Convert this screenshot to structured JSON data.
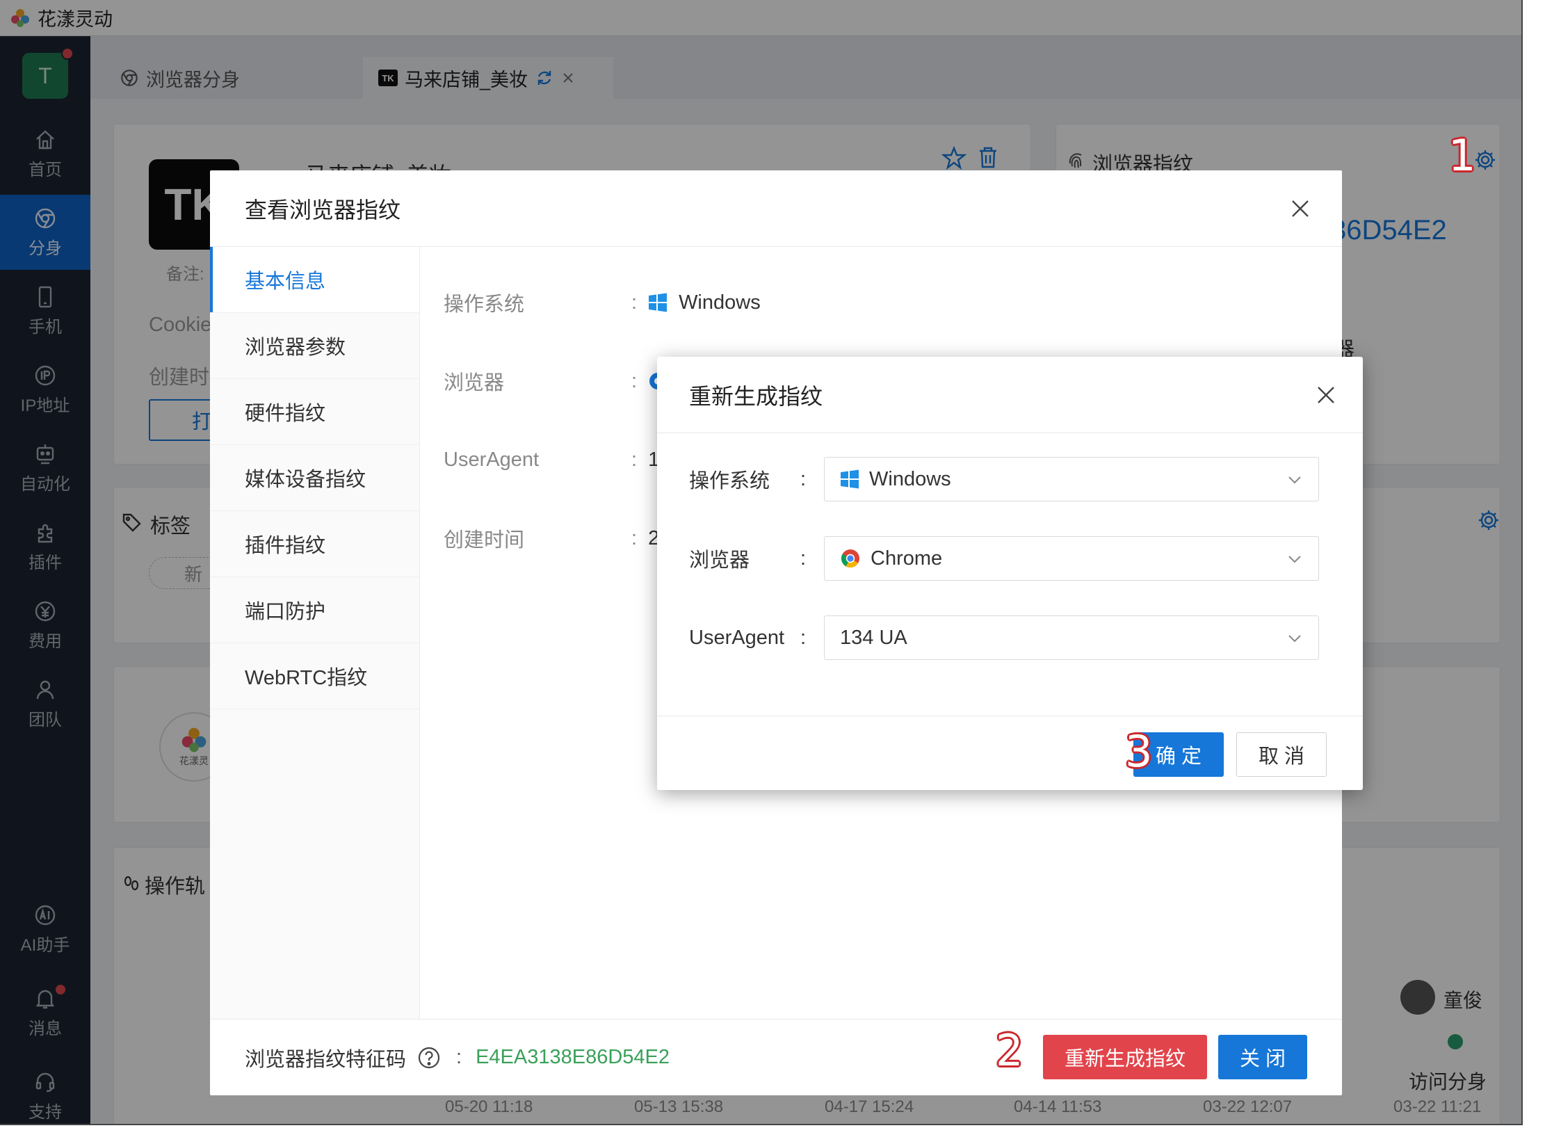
{
  "app": {
    "title": "花漾灵动",
    "avatar_letter": "T"
  },
  "sidebar": {
    "items": [
      {
        "label": "首页",
        "icon": "home-icon"
      },
      {
        "label": "分身",
        "icon": "browser-icon"
      },
      {
        "label": "手机",
        "icon": "phone-icon"
      },
      {
        "label": "IP地址",
        "icon": "ip-icon"
      },
      {
        "label": "自动化",
        "icon": "robot-icon"
      },
      {
        "label": "插件",
        "icon": "plugin-icon"
      },
      {
        "label": "费用",
        "icon": "yen-icon"
      },
      {
        "label": "团队",
        "icon": "team-icon"
      },
      {
        "label": "AI助手",
        "icon": "ai-icon"
      },
      {
        "label": "消息",
        "icon": "bell-icon"
      },
      {
        "label": "支持",
        "icon": "headset-icon"
      }
    ],
    "active_index": 1
  },
  "tabs": [
    {
      "label": "浏览器分身"
    },
    {
      "label": "马来店铺_美妆",
      "badge": "TK"
    }
  ],
  "background": {
    "profile_name": "马来店铺_美妆",
    "note_label": "备注:",
    "cookie_label": "Cookie",
    "created_label": "创建时",
    "open_button": "打",
    "fingerprint_card_title": "浏览器指纹",
    "fingerprint_partial": "36D54E2",
    "browser_partial": "器",
    "tag_section_title": "标签",
    "add_tag": "新",
    "track_section_title": "操作轨",
    "logo_text": "花漾灵",
    "user_name": "童俊",
    "visit_label": "访问分身",
    "timeline": [
      "05-20 11:18",
      "05-13 15:38",
      "04-17 15:24",
      "04-14 11:53",
      "03-22 12:07",
      "03-22 11:21"
    ]
  },
  "fingerprint_modal": {
    "title": "查看浏览器指纹",
    "menu": [
      "基本信息",
      "浏览器参数",
      "硬件指纹",
      "媒体设备指纹",
      "插件指纹",
      "端口防护",
      "WebRTC指纹"
    ],
    "active_menu": 0,
    "rows": [
      {
        "key": "操作系统",
        "value": "Windows"
      },
      {
        "key": "浏览器",
        "value": ""
      },
      {
        "key": "UserAgent",
        "value": "13"
      },
      {
        "key": "创建时间",
        "value": "20"
      }
    ],
    "footer_label": "浏览器指纹特征码",
    "footer_code": "E4EA3138E86D54E2",
    "regenerate_button": "重新生成指纹",
    "close_button": "关 闭"
  },
  "regen_dialog": {
    "title": "重新生成指纹",
    "fields": [
      {
        "label": "操作系统",
        "value": "Windows",
        "icon": "windows-icon"
      },
      {
        "label": "浏览器",
        "value": "Chrome",
        "icon": "chrome-icon"
      },
      {
        "label": "UserAgent",
        "value": "134 UA",
        "icon": ""
      }
    ],
    "ok_button": "确 定",
    "cancel_button": "取 消"
  },
  "annotations": [
    "1",
    "2",
    "3"
  ],
  "colors": {
    "sidebar_bg": "#1c2533",
    "accent_blue": "#1677d9",
    "danger_red": "#e2444b",
    "code_green": "#3aa05a",
    "annotation_red": "#c9282e"
  }
}
